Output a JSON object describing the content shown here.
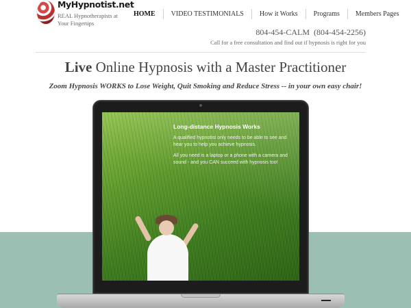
{
  "brand": {
    "name": "MyHypnotist.net",
    "tagline": "REAL Hypnotherapists at Your Fingertips"
  },
  "nav": {
    "items": [
      {
        "label": "HOME",
        "active": true
      },
      {
        "label": "VIDEO TESTIMONIALS",
        "active": false
      },
      {
        "label": "How it Works",
        "active": false
      },
      {
        "label": "Programs",
        "active": false
      },
      {
        "label": "Members Pages",
        "active": false
      }
    ]
  },
  "contact": {
    "phone_word": "804-454-CALM",
    "phone_number": "(804-454-2256)",
    "note": "Call for a free consultation and find out if hypnosis is right for you"
  },
  "hero": {
    "headline_bold": "Live",
    "headline_rest": " Online Hypnosis with a Master Practitioner",
    "subheadline": "Zoom Hypnosis WORKS to Lose Weight, Quit Smoking and Reduce Stress -- in your own easy chair!"
  },
  "screen": {
    "title": "Long-distance Hypnosis Works",
    "paragraph1": "A qualified hypnotist only needs to be able to see and hear you to help you achieve hypnosis.",
    "paragraph2": "All you need is a laptop or a phone with a camera and sound - and you CAN succeed with hypnosis too!"
  },
  "colors": {
    "band": "#9bbfb2",
    "grass": "#5f9a2c",
    "laptop_frame": "#1c1c1c"
  }
}
